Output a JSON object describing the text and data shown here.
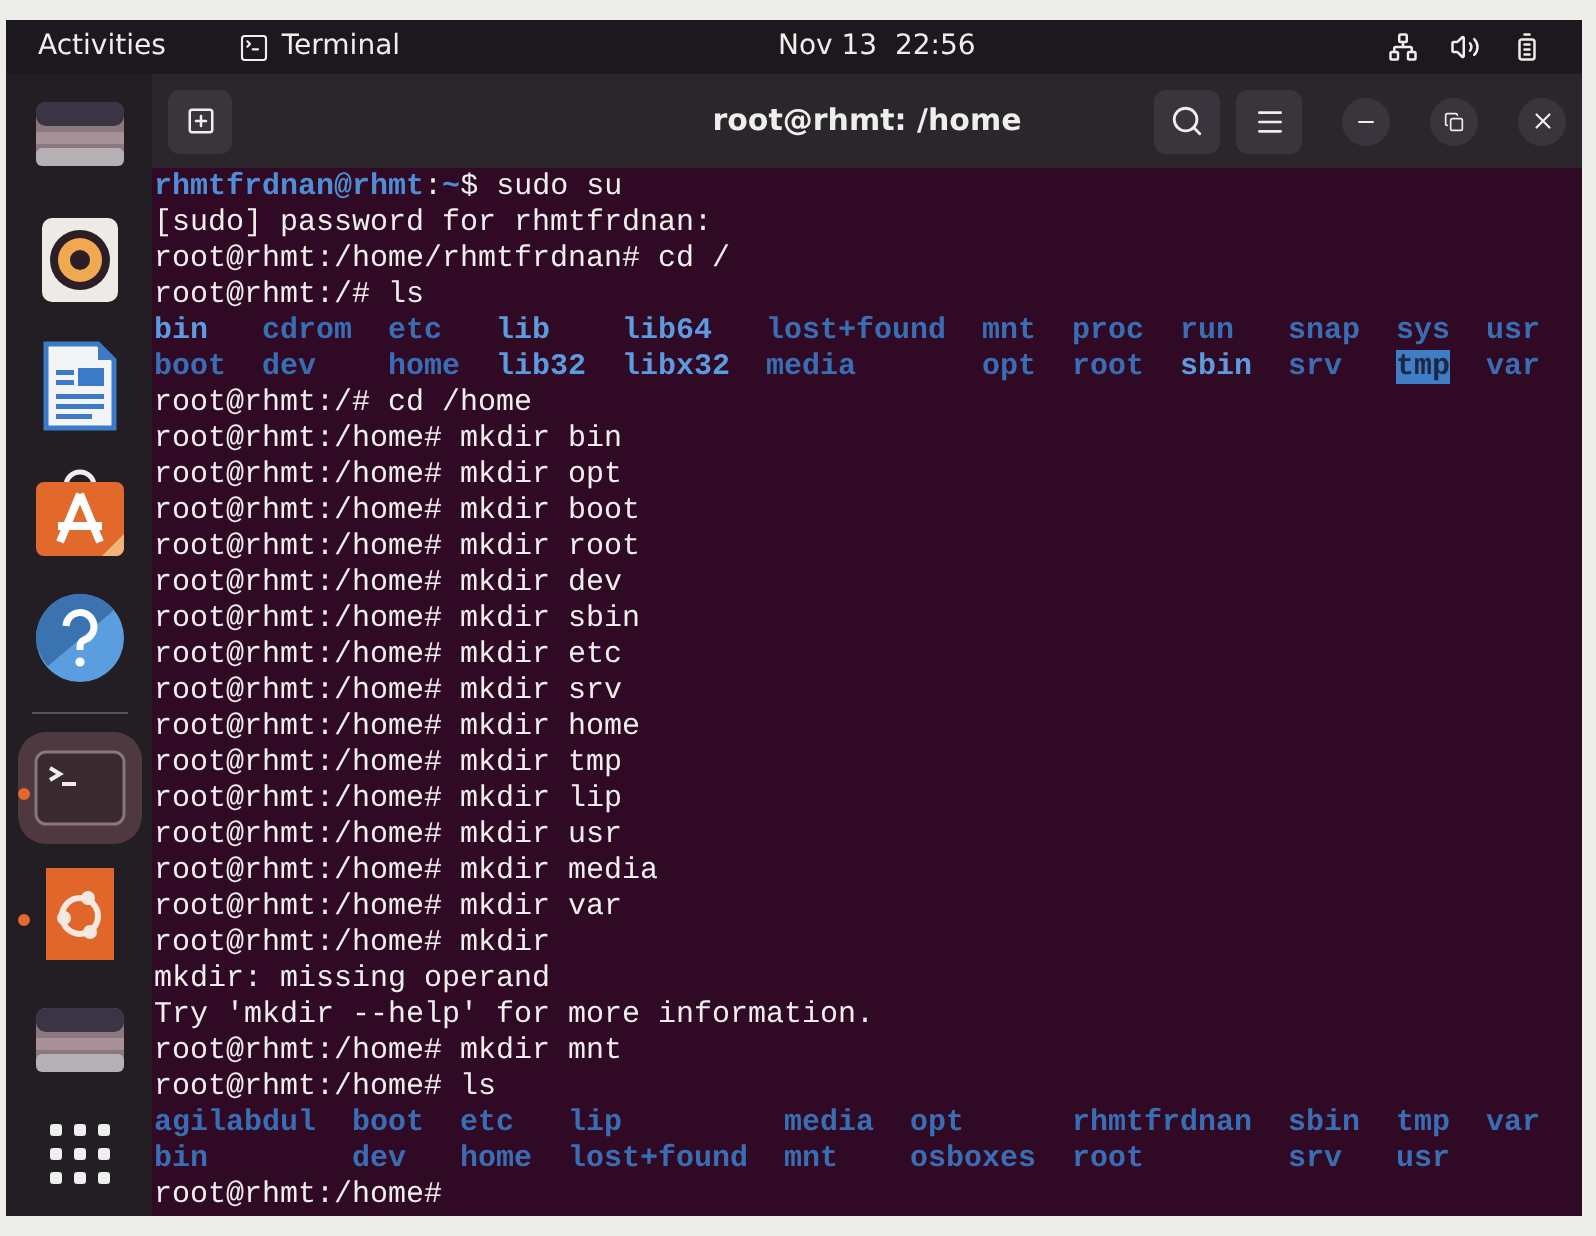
{
  "top_bar": {
    "activities": "Activities",
    "app_name": "Terminal",
    "clock": "Nov 13  22:56"
  },
  "dock": {
    "favorites": [
      {
        "kind": "drive",
        "running": false,
        "selected": false
      },
      {
        "kind": "music",
        "running": false,
        "selected": false
      },
      {
        "kind": "document",
        "running": false,
        "selected": false
      },
      {
        "kind": "store",
        "running": false,
        "selected": false
      },
      {
        "kind": "help",
        "running": false,
        "selected": false
      }
    ],
    "others": [
      {
        "kind": "terminal",
        "running": true,
        "selected": true
      },
      {
        "kind": "ubuntu",
        "running": true,
        "selected": false
      },
      {
        "kind": "drive",
        "running": false,
        "selected": false
      }
    ]
  },
  "terminal": {
    "title": "root@rhmt: /home",
    "lines": [
      {
        "kind": "user_prompt",
        "user": "rhmtfrdnan@rhmt",
        "sep": ":",
        "path": "~",
        "command": "$ sudo su"
      },
      {
        "kind": "text",
        "text": "[sudo] password for rhmtfrdnan:"
      },
      {
        "kind": "text",
        "text": "root@rhmt:/home/rhmtfrdnan# cd /"
      },
      {
        "kind": "text",
        "text": "root@rhmt:/# ls"
      },
      {
        "kind": "listing",
        "rows": [
          [
            {
              "text": "bin",
              "kind": "link"
            },
            {
              "text": "cdrom",
              "kind": "dir"
            },
            {
              "text": "etc",
              "kind": "dir"
            },
            {
              "text": "lib",
              "kind": "link"
            },
            {
              "text": "lib64",
              "kind": "link"
            },
            {
              "text": "lost+found",
              "kind": "dir"
            },
            {
              "text": "mnt",
              "kind": "dir"
            },
            {
              "text": "proc",
              "kind": "dir"
            },
            {
              "text": "run",
              "kind": "dir"
            },
            {
              "text": "snap",
              "kind": "dir"
            },
            {
              "text": "sys",
              "kind": "dir"
            },
            {
              "text": "usr",
              "kind": "dir"
            }
          ],
          [
            {
              "text": "boot",
              "kind": "dir"
            },
            {
              "text": "dev",
              "kind": "dir"
            },
            {
              "text": "home",
              "kind": "dir"
            },
            {
              "text": "lib32",
              "kind": "link"
            },
            {
              "text": "libx32",
              "kind": "link"
            },
            {
              "text": "media",
              "kind": "dir"
            },
            {
              "text": "opt",
              "kind": "dir"
            },
            {
              "text": "root",
              "kind": "dir"
            },
            {
              "text": "sbin",
              "kind": "link"
            },
            {
              "text": "srv",
              "kind": "dir"
            },
            {
              "text": "tmp",
              "kind": "sticky"
            },
            {
              "text": "var",
              "kind": "dir"
            }
          ]
        ]
      },
      {
        "kind": "text",
        "text": "root@rhmt:/# cd /home"
      },
      {
        "kind": "text",
        "text": "root@rhmt:/home# mkdir bin"
      },
      {
        "kind": "text",
        "text": "root@rhmt:/home# mkdir opt"
      },
      {
        "kind": "text",
        "text": "root@rhmt:/home# mkdir boot"
      },
      {
        "kind": "text",
        "text": "root@rhmt:/home# mkdir root"
      },
      {
        "kind": "text",
        "text": "root@rhmt:/home# mkdir dev"
      },
      {
        "kind": "text",
        "text": "root@rhmt:/home# mkdir sbin"
      },
      {
        "kind": "text",
        "text": "root@rhmt:/home# mkdir etc"
      },
      {
        "kind": "text",
        "text": "root@rhmt:/home# mkdir srv"
      },
      {
        "kind": "text",
        "text": "root@rhmt:/home# mkdir home"
      },
      {
        "kind": "text",
        "text": "root@rhmt:/home# mkdir tmp"
      },
      {
        "kind": "text",
        "text": "root@rhmt:/home# mkdir lip"
      },
      {
        "kind": "text",
        "text": "root@rhmt:/home# mkdir usr"
      },
      {
        "kind": "text",
        "text": "root@rhmt:/home# mkdir media"
      },
      {
        "kind": "text",
        "text": "root@rhmt:/home# mkdir var"
      },
      {
        "kind": "text",
        "text": "root@rhmt:/home# mkdir"
      },
      {
        "kind": "text",
        "text": "mkdir: missing operand"
      },
      {
        "kind": "text",
        "text": "Try 'mkdir --help' for more information."
      },
      {
        "kind": "text",
        "text": "root@rhmt:/home# mkdir mnt"
      },
      {
        "kind": "text",
        "text": "root@rhmt:/home# ls"
      },
      {
        "kind": "listing",
        "rows": [
          [
            {
              "text": "agilabdul",
              "kind": "dir"
            },
            {
              "text": "boot",
              "kind": "dir"
            },
            {
              "text": "etc",
              "kind": "dir"
            },
            {
              "text": "lip",
              "kind": "dir"
            },
            {
              "text": "media",
              "kind": "dir"
            },
            {
              "text": "opt",
              "kind": "dir"
            },
            {
              "text": "rhmtfrdnan",
              "kind": "dir"
            },
            {
              "text": "sbin",
              "kind": "dir"
            },
            {
              "text": "tmp",
              "kind": "dir"
            },
            {
              "text": "var",
              "kind": "dir"
            }
          ],
          [
            {
              "text": "bin",
              "kind": "dir"
            },
            {
              "text": "dev",
              "kind": "dir"
            },
            {
              "text": "home",
              "kind": "dir"
            },
            {
              "text": "lost+found",
              "kind": "dir"
            },
            {
              "text": "mnt",
              "kind": "dir"
            },
            {
              "text": "osboxes",
              "kind": "dir"
            },
            {
              "text": "root",
              "kind": "dir"
            },
            {
              "text": "srv",
              "kind": "dir"
            },
            {
              "text": "usr",
              "kind": "dir"
            }
          ]
        ]
      },
      {
        "kind": "text",
        "text": "root@rhmt:/home#"
      }
    ]
  }
}
